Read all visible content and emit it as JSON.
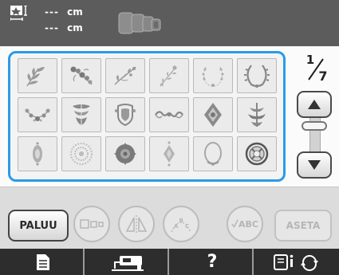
{
  "header": {
    "height_value": "---",
    "height_unit": "cm",
    "width_value": "---",
    "width_unit": "cm",
    "size_icon": "embroidery-size-icon",
    "frame_icon": "embroidery-frames-icon"
  },
  "pattern_grid": {
    "tiles": [
      {
        "icon": "leaf-sprig-pattern-icon"
      },
      {
        "icon": "floral-spray-pattern-icon"
      },
      {
        "icon": "vine-pattern-icon"
      },
      {
        "icon": "branch-pattern-icon"
      },
      {
        "icon": "open-wreath-pattern-icon"
      },
      {
        "icon": "laurel-wreath-pattern-icon"
      },
      {
        "icon": "floral-swag-pattern-icon"
      },
      {
        "icon": "crest-pattern-icon"
      },
      {
        "icon": "shield-ornament-pattern-icon"
      },
      {
        "icon": "scroll-border-pattern-icon"
      },
      {
        "icon": "diamond-medallion-pattern-icon"
      },
      {
        "icon": "ornate-motif-pattern-icon"
      },
      {
        "icon": "small-ornament-pattern-icon"
      },
      {
        "icon": "round-lace-pattern-icon"
      },
      {
        "icon": "filled-medallion-pattern-icon"
      },
      {
        "icon": "small-diamond-pattern-icon"
      },
      {
        "icon": "oval-wreath-pattern-icon"
      },
      {
        "icon": "round-frame-pattern-icon"
      }
    ]
  },
  "pagination": {
    "current": "1",
    "total": "7"
  },
  "buttons": {
    "back_label": "PALUU",
    "set_label": "ASETA",
    "abc_label": "ABC",
    "arc_text_letters": [
      "A",
      "B",
      "C"
    ]
  },
  "colors": {
    "accent_blue": "#2a9be6",
    "header_bg": "#5c5c5c",
    "nav_bg": "#2d2d2d",
    "disabled_gray": "#bdbdbd"
  },
  "nav": {
    "items": [
      {
        "icon": "document-icon"
      },
      {
        "icon": "sewing-machine-icon"
      },
      {
        "icon": "help-icon",
        "label": "?"
      },
      {
        "icon": "settings-rotate-icon"
      }
    ]
  }
}
